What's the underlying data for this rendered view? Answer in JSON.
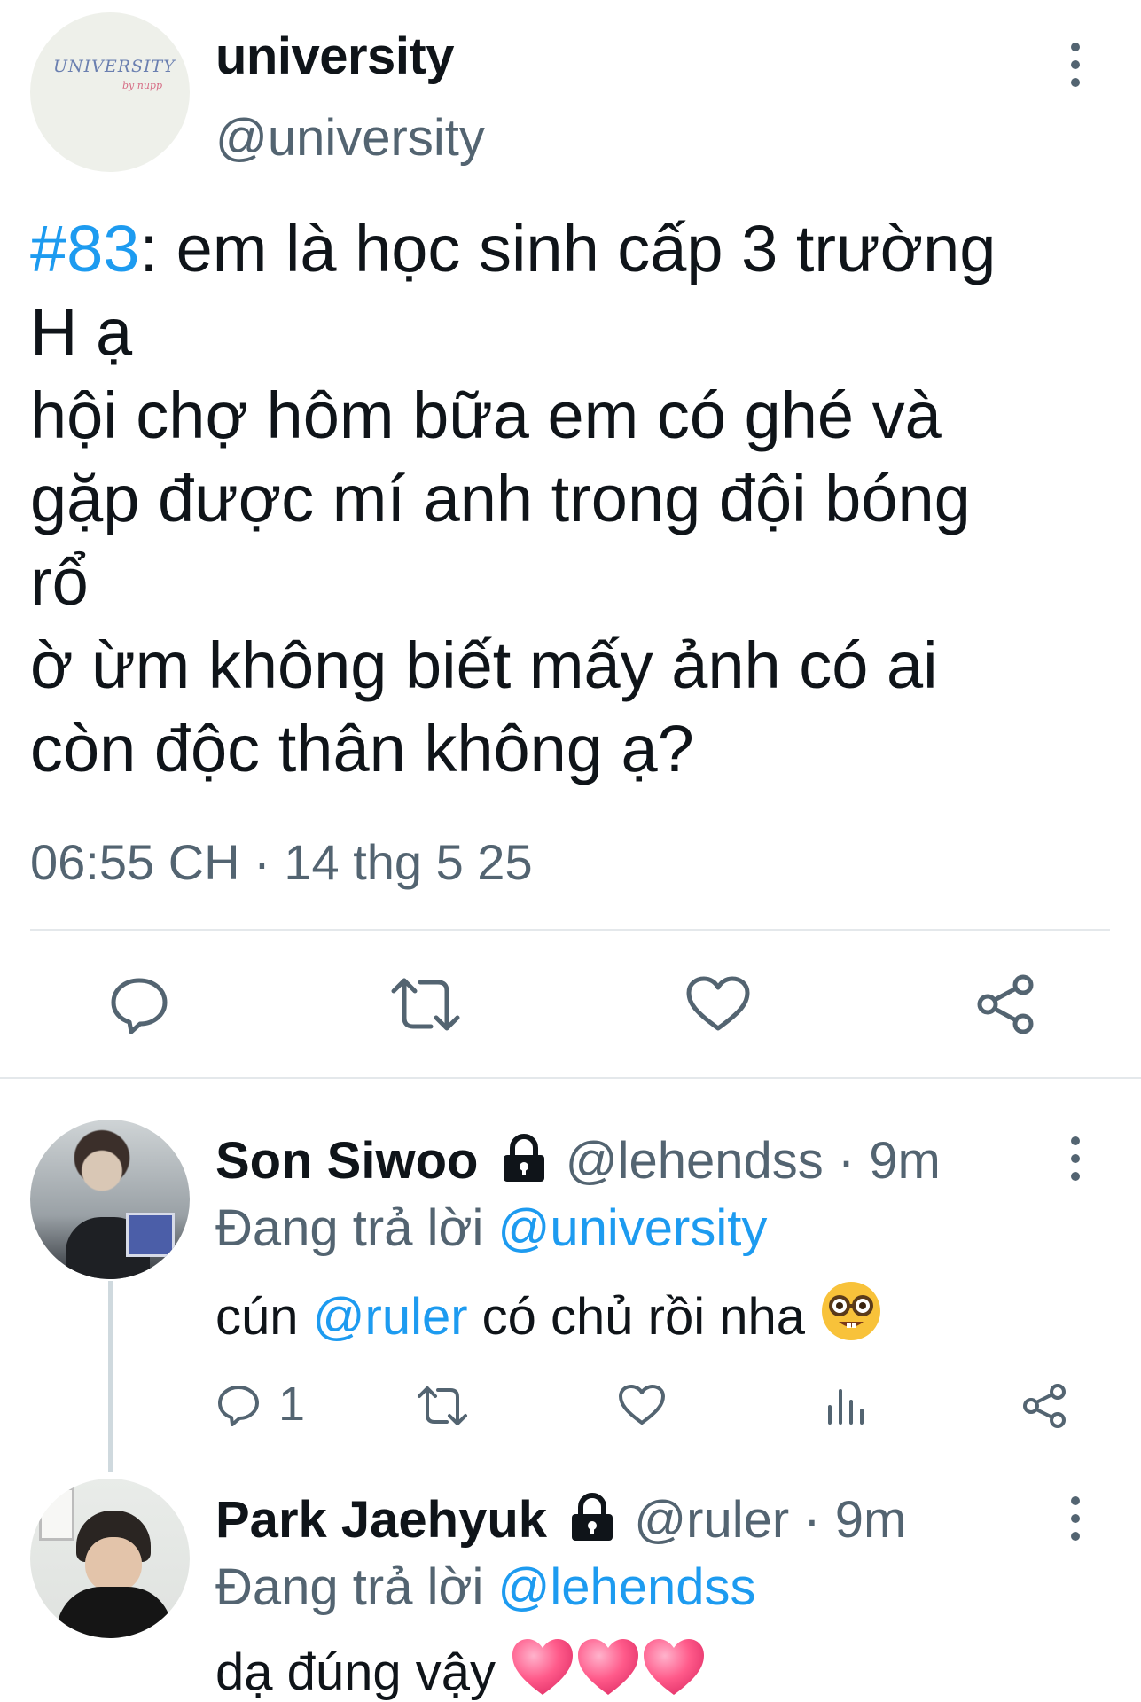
{
  "main_tweet": {
    "avatar_text": "UNIVERSITY",
    "avatar_sub": "by nupp",
    "display_name": "university",
    "handle": "@university",
    "hashtag": "#83",
    "text_lines": [
      ": em là học sinh cấp 3 trường",
      "H ạ",
      "hội chợ hôm bữa em có ghé và",
      "gặp được mí anh trong đội bóng",
      "rổ",
      "ờ ừm không biết mấy ảnh có ai",
      "còn độc thân không ạ?"
    ],
    "timestamp": "06:55 CH · 14 thg 5 25",
    "actions": [
      "reply-icon",
      "retweet-icon",
      "like-icon",
      "share-icon"
    ]
  },
  "replies": [
    {
      "display_name": "Son Siwoo",
      "handle_time": "@lehendss · 9m",
      "replying_prefix": "Đang trả lời ",
      "replying_to": "@university",
      "body_before": "cún ",
      "body_mention": "@ruler",
      "body_after": " có chủ rồi nha ",
      "emoji": "nerd-face",
      "reply_count": "1",
      "actions": [
        "reply-icon",
        "retweet-icon",
        "like-icon",
        "views-icon",
        "share-icon"
      ]
    },
    {
      "display_name": "Park Jaehyuk",
      "handle_time": "@ruler · 9m",
      "replying_prefix": "Đang trả lời ",
      "replying_to": "@lehendss",
      "body": "dạ đúng vậy ",
      "emoji": "pink-hearts"
    }
  ],
  "colors": {
    "link": "#1d9bf0",
    "secondary": "#536471",
    "primary": "#0f1419",
    "heart": "#ff5a8a"
  }
}
